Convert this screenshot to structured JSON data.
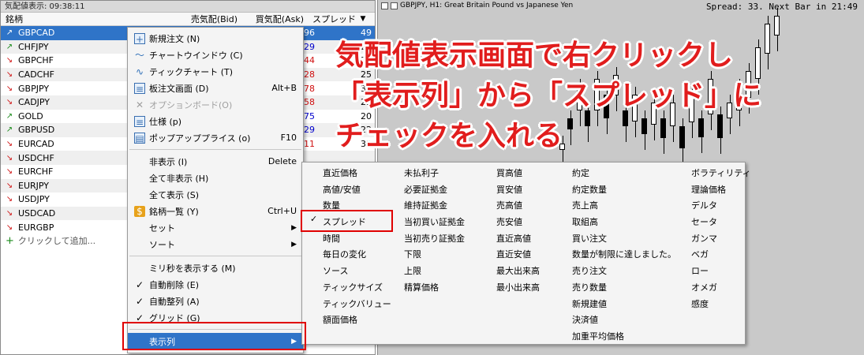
{
  "market_watch": {
    "title": "気配値表示: 09:38:11",
    "col_symbol": "銘柄",
    "col_bid": "売気配(Bid)",
    "col_ask": "買気配(Ask)",
    "col_spread": "スプレッド",
    "add_label": "クリックして追加...",
    "rows": [
      {
        "symbol": "GBPCAD",
        "dir": "up",
        "ask_tail": "96",
        "spread": "49"
      },
      {
        "symbol": "CHFJPY",
        "dir": "up",
        "ask_tail": "29",
        "spread": "21"
      },
      {
        "symbol": "GBPCHF",
        "dir": "down",
        "ask_tail": "44",
        "spread": "35"
      },
      {
        "symbol": "CADCHF",
        "dir": "down",
        "ask_tail": "28",
        "spread": "25"
      },
      {
        "symbol": "GBPJPY",
        "dir": "down",
        "ask_tail": "78",
        "spread": "33"
      },
      {
        "symbol": "CADJPY",
        "dir": "down",
        "ask_tail": "58",
        "spread": "25"
      },
      {
        "symbol": "GOLD",
        "dir": "up",
        "ask_tail": "75",
        "spread": "20"
      },
      {
        "symbol": "GBPUSD",
        "dir": "up",
        "ask_tail": "29",
        "spread": "22"
      },
      {
        "symbol": "EURCAD",
        "dir": "down",
        "ask_tail": "11",
        "spread": "30"
      },
      {
        "symbol": "USDCHF",
        "dir": "down",
        "ask_tail": "",
        "spread": ""
      },
      {
        "symbol": "EURCHF",
        "dir": "down",
        "ask_tail": "",
        "spread": ""
      },
      {
        "symbol": "EURJPY",
        "dir": "down",
        "ask_tail": "",
        "spread": ""
      },
      {
        "symbol": "USDJPY",
        "dir": "down",
        "ask_tail": "",
        "spread": ""
      },
      {
        "symbol": "USDCAD",
        "dir": "down",
        "ask_tail": "",
        "spread": ""
      },
      {
        "symbol": "EURGBP",
        "dir": "down",
        "ask_tail": "",
        "spread": ""
      }
    ]
  },
  "context_menu": {
    "new_order": "新規注文 (N)",
    "chart_window": "チャートウインドウ (C)",
    "tick_chart": "ティックチャート (T)",
    "depth": "板注文画面 (D)",
    "depth_shortcut": "Alt+B",
    "options": "オプションボード(O)",
    "spec": "仕様 (p)",
    "popup": "ポップアッププライス (o)",
    "popup_shortcut": "F10",
    "hide": "非表示 (I)",
    "hide_shortcut": "Delete",
    "hide_all": "全て非表示 (H)",
    "show_all": "全て表示 (S)",
    "symbols": "銘柄一覧 (Y)",
    "symbols_shortcut": "Ctrl+U",
    "sets": "セット",
    "sort": "ソート",
    "ms": "ミリ秒を表示する (M)",
    "autoremove": "自動削除 (E)",
    "autoarrange": "自動整列 (A)",
    "grid": "グリッド (G)",
    "columns": "表示列"
  },
  "submenu": {
    "col1": [
      "直近価格",
      "高値/安値",
      "数量",
      "スプレッド",
      "時間",
      "毎日の変化",
      "ソース",
      "ティックサイズ",
      "ティックバリュー",
      "額面価格"
    ],
    "col2": [
      "未払利子",
      "必要証拠金",
      "維持証拠金",
      "当初買い証拠金",
      "当初売り証拠金",
      "下限",
      "上限",
      "精算価格"
    ],
    "col3": [
      "買高値",
      "買安値",
      "売高値",
      "売安値",
      "直近高値",
      "直近安値",
      "最大出来高",
      "最小出来高"
    ],
    "col4": [
      "約定",
      "約定数量",
      "売上高",
      "取組高",
      "買い注文",
      "数量が制限に達しました。",
      "売り注文",
      "売り数量",
      "新規建値",
      "決済値",
      "加重平均価格"
    ],
    "col5": [
      "ボラティリティ",
      "理論価格",
      "デルタ",
      "セータ",
      "ガンマ",
      "ベガ",
      "ロー",
      "オメガ",
      "感度"
    ]
  },
  "chart": {
    "title": "GBPJPY, H1:  Great Britain Pound vs Japanese Yen",
    "spread_text": "Spread: 33. Next Bar in 21:49"
  },
  "annotation": {
    "line1": "気配値表示画面で右クリックし",
    "line2": "「表示列」から「スプレッド」に",
    "line3": "チェックを入れる"
  }
}
